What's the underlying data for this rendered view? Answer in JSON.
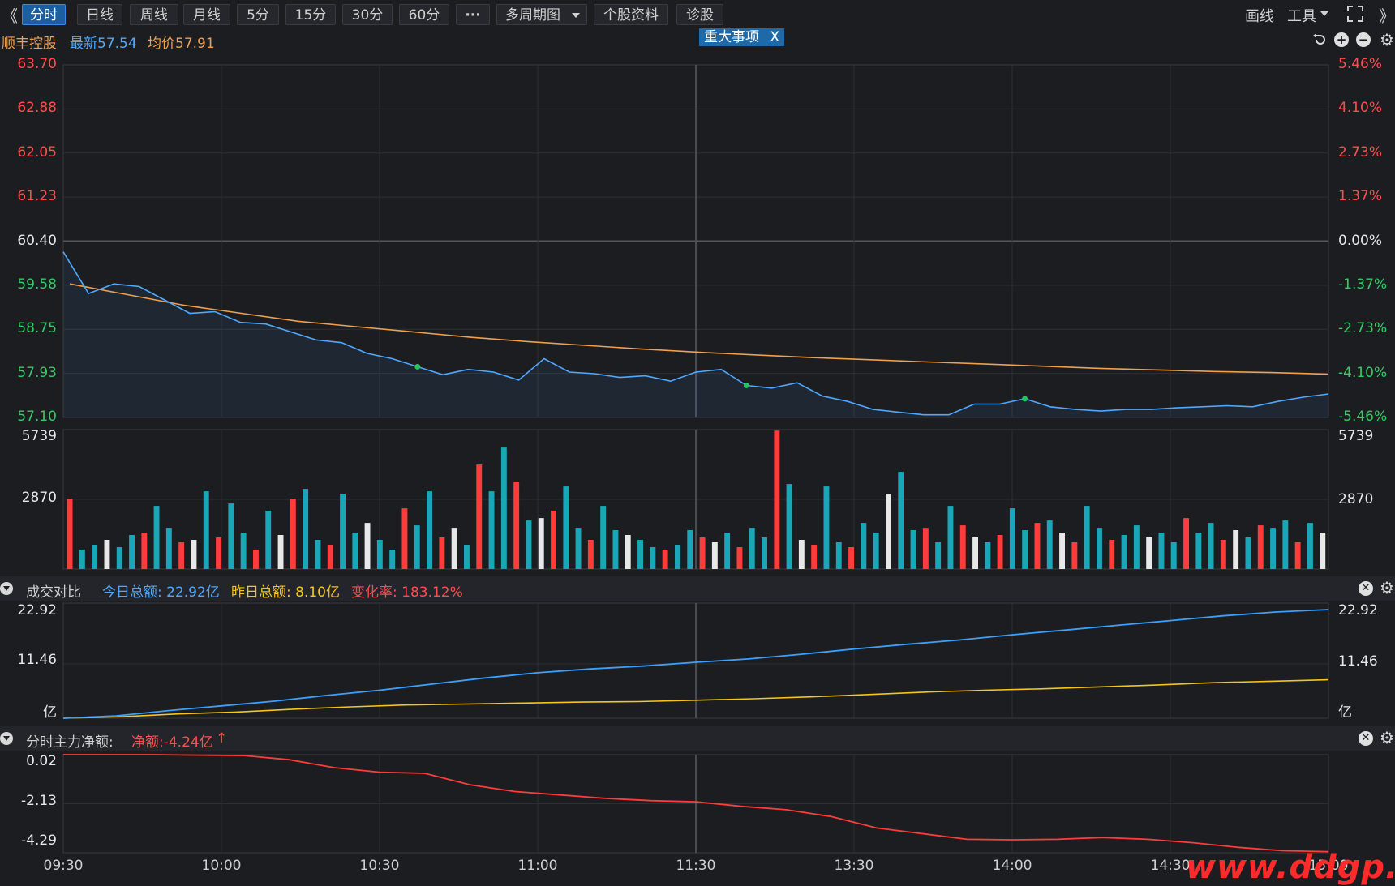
{
  "toolbar": {
    "collapse_left": "《",
    "tabs": [
      "分时",
      "日线",
      "周线",
      "月线",
      "5分",
      "15分",
      "30分",
      "60分",
      "···",
      "多周期图",
      "个股资料",
      "诊股"
    ],
    "active_tab": "分时",
    "draw_label": "画线",
    "tools_label": "工具",
    "expand_right": "》"
  },
  "info": {
    "stock_name": "顺丰控股",
    "latest_label": "最新57.54",
    "avg_label": "均价57.91",
    "event_tag": "重大事项",
    "event_close": "X"
  },
  "price_axis": {
    "left": [
      "63.70",
      "62.88",
      "62.05",
      "61.23",
      "60.40",
      "59.58",
      "58.75",
      "57.93",
      "57.10"
    ],
    "right": [
      "5.46%",
      "4.10%",
      "2.73%",
      "1.37%",
      "0.00%",
      "-1.37%",
      "-2.73%",
      "-4.10%",
      "-5.46%"
    ]
  },
  "volume_axis": {
    "left": [
      "5739",
      "2870"
    ],
    "right": [
      "5739",
      "2870"
    ]
  },
  "turnover_panel": {
    "title": "成交对比",
    "today_label": "今日总额: 22.92亿",
    "yesterday_label": "昨日总额: 8.10亿",
    "change_label": "变化率: 183.12%",
    "axis_left": [
      "22.92",
      "11.46",
      "亿"
    ],
    "axis_right": [
      "22.92",
      "11.46",
      "亿"
    ]
  },
  "mainforce_panel": {
    "title": "分时主力净额:",
    "net_label": "净额:-4.24亿",
    "axis_left": [
      "0.02",
      "-2.13",
      "-4.29"
    ]
  },
  "time_axis": [
    "09:30",
    "10:00",
    "10:30",
    "11:00",
    "11:30",
    "13:30",
    "14:00",
    "14:30",
    "15:00"
  ],
  "watermark": "www.ddgp.net",
  "colors": {
    "price_line": "#4fa8ff",
    "avg_line": "#f0a04b",
    "today_line": "#3aa0ff",
    "yesterday_line": "#f5c518",
    "net_line": "#ff3b3b",
    "up": "#ff3b3b",
    "down": "#19a7b8",
    "flat": "#e8e8e8"
  },
  "chart_data": [
    {
      "type": "line",
      "title": "",
      "ylim": [
        57.1,
        63.7
      ],
      "prev_close": 60.4,
      "x_ticks": [
        "09:30",
        "10:00",
        "10:30",
        "11:00",
        "11:30/13:00",
        "13:30",
        "14:00",
        "14:30",
        "15:00"
      ],
      "series": [
        {
          "name": "最新",
          "values": [
            60.2,
            59.42,
            59.6,
            59.55,
            59.3,
            59.05,
            59.08,
            58.88,
            58.85,
            58.7,
            58.55,
            58.5,
            58.3,
            58.2,
            58.05,
            57.9,
            58.0,
            57.95,
            57.8,
            58.2,
            57.95,
            57.92,
            57.85,
            57.88,
            57.78,
            57.95,
            58.0,
            57.7,
            57.65,
            57.75,
            57.5,
            57.4,
            57.25,
            57.2,
            57.15,
            57.15,
            57.35,
            57.35,
            57.45,
            57.3,
            57.25,
            57.22,
            57.25,
            57.25,
            57.28,
            57.3,
            57.32,
            57.3,
            57.4,
            57.48,
            57.54
          ]
        },
        {
          "name": "均价",
          "values": [
            59.6,
            59.4,
            59.2,
            59.05,
            58.9,
            58.8,
            58.7,
            58.6,
            58.52,
            58.45,
            58.38,
            58.32,
            58.27,
            58.22,
            58.18,
            58.14,
            58.1,
            58.06,
            58.02,
            57.99,
            57.96,
            57.94,
            57.91
          ]
        }
      ]
    },
    {
      "type": "bar",
      "title": "",
      "ylim": [
        0,
        5739
      ],
      "note": "per-minute volume, colored red (up) / teal (down) / white (flat)",
      "values": [
        2900,
        800,
        1000,
        1200,
        900,
        1400,
        1500,
        2600,
        1700,
        1100,
        1200,
        3200,
        1300,
        2700,
        1500,
        800,
        2400,
        1400,
        2900,
        3300,
        1200,
        1000,
        3100,
        1500,
        1900,
        1200,
        800,
        2500,
        1800,
        3200,
        1300,
        1700,
        1000,
        4300,
        3200,
        5000,
        3600,
        2000,
        2100,
        2400,
        3400,
        1700,
        1200,
        2600,
        1600,
        1400,
        1200,
        900,
        800,
        1000,
        1600,
        1300,
        1100,
        1500,
        900,
        1700,
        1300,
        5700,
        3500,
        1200,
        1000,
        3400,
        1100,
        900,
        1900,
        1500,
        3100,
        4000,
        1600,
        1700,
        1100,
        2600,
        1800,
        1300,
        1100,
        1400,
        2500,
        1600,
        1900,
        2000,
        1500,
        1100,
        2600,
        1700,
        1200,
        1400,
        1800,
        1300,
        1500,
        1100,
        2100,
        1500,
        1900,
        1200,
        1600,
        1300,
        1800,
        1700,
        2000,
        1100,
        1900,
        1500
      ]
    },
    {
      "type": "line",
      "title": "成交对比",
      "ylim": [
        0,
        22.92
      ],
      "series": [
        {
          "name": "今日总额",
          "values": [
            0,
            0.5,
            1.6,
            2.6,
            3.6,
            4.8,
            5.9,
            7.2,
            8.5,
            9.6,
            10.4,
            11.0,
            11.8,
            12.5,
            13.5,
            14.6,
            15.6,
            16.5,
            17.6,
            18.6,
            19.6,
            20.6,
            21.6,
            22.4,
            22.92
          ]
        },
        {
          "name": "昨日总额",
          "values": [
            0,
            0.3,
            0.9,
            1.3,
            1.9,
            2.4,
            2.8,
            3.0,
            3.2,
            3.4,
            3.5,
            3.8,
            4.1,
            4.5,
            5.0,
            5.5,
            5.9,
            6.2,
            6.6,
            7.0,
            7.5,
            7.8,
            8.1
          ]
        }
      ]
    },
    {
      "type": "line",
      "title": "分时主力净额",
      "ylim": [
        -4.29,
        0.02
      ],
      "series": [
        {
          "name": "净额",
          "values": [
            0.02,
            0.02,
            0.02,
            0.0,
            -0.02,
            -0.2,
            -0.55,
            -0.75,
            -0.8,
            -1.3,
            -1.6,
            -1.75,
            -1.9,
            -2.0,
            -2.05,
            -2.25,
            -2.4,
            -2.7,
            -3.2,
            -3.45,
            -3.7,
            -3.72,
            -3.7,
            -3.62,
            -3.7,
            -3.85,
            -4.05,
            -4.2,
            -4.24
          ]
        }
      ]
    }
  ]
}
